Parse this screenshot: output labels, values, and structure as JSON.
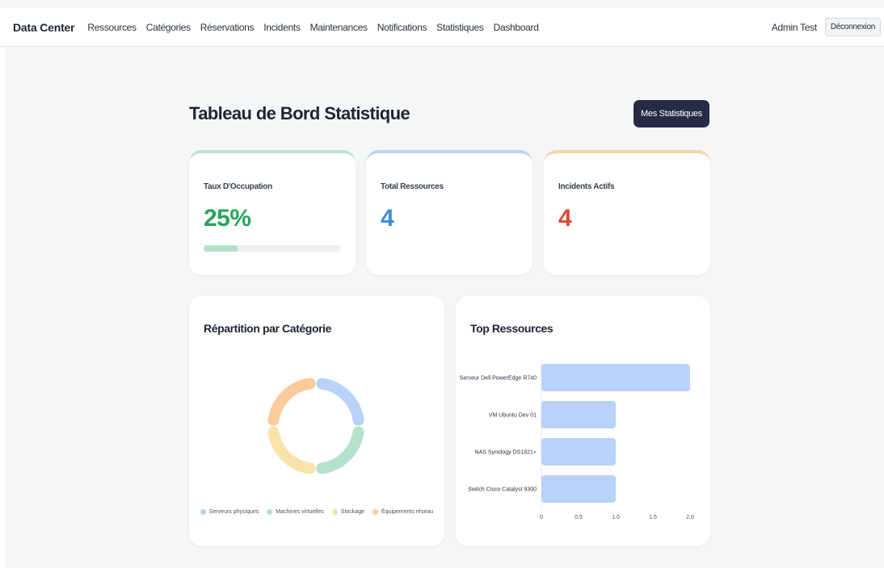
{
  "nav": {
    "brand": "Data Center",
    "links": [
      "Ressources",
      "Catégories",
      "Réservations",
      "Incidents",
      "Maintenances",
      "Notifications",
      "Statistiques",
      "Dashboard"
    ],
    "user": "Admin Test",
    "logout": "Déconnexion"
  },
  "page": {
    "title": "Tableau de Bord Statistique",
    "stats_button": "Mes Statistiques"
  },
  "cards": {
    "occupancy": {
      "label": "Taux D'Occupation",
      "value": "25%",
      "progress": 0.25,
      "color": "#27a55a"
    },
    "resources": {
      "label": "Total Ressources",
      "value": "4",
      "color": "#3a90d4"
    },
    "incidents": {
      "label": "Incidents Actifs",
      "value": "4",
      "color": "#d94a3c"
    }
  },
  "category_panel": {
    "title": "Répartition par Catégorie"
  },
  "top_panel": {
    "title": "Top Ressources"
  },
  "chart_data": [
    {
      "type": "pie",
      "categories": [
        "Serveurs physiques",
        "Machines virtuelles",
        "Stockage",
        "Équipements réseau"
      ],
      "values": [
        1,
        1,
        1,
        1
      ],
      "colors": [
        "#b8d2fa",
        "#b5e2cb",
        "#f8e3a9",
        "#fccb9c"
      ],
      "legend": "bottom"
    },
    {
      "type": "bar",
      "orientation": "horizontal",
      "categories": [
        "Serveur Dell PowerEdge R740",
        "VM Ubuntu Dev 01",
        "NAS Synology DS1821+",
        "Switch Cisco Catalyst 9300"
      ],
      "values": [
        2,
        1,
        1,
        1
      ],
      "xticks": [
        "0",
        "0.5",
        "1.0",
        "1.5",
        "2.0"
      ],
      "xlim": [
        0,
        2
      ],
      "color": "#b8d2fa"
    }
  ]
}
